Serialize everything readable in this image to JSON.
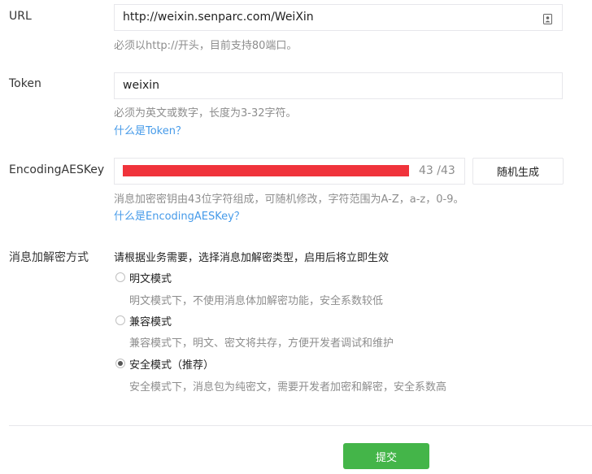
{
  "url": {
    "label": "URL",
    "value": "http://weixin.senparc.com/WeiXin",
    "tip": "必须以http://开头，目前支持80端口。",
    "icon": "contact-card-icon"
  },
  "token": {
    "label": "Token",
    "value": "weixin",
    "tip": "必须为英文或数字，长度为3-32字符。",
    "help_link": "什么是Token？"
  },
  "aes": {
    "label": "EncodingAESKey",
    "counter": "43 /43",
    "generate_button": "随机生成",
    "tip": "消息加密密钥由43位字符组成，可随机修改，字符范围为A-Z，a-z，0-9。",
    "help_link": "什么是EncodingAESKey？",
    "redaction_color": "#f0333b"
  },
  "encryption": {
    "label": "消息加解密方式",
    "intro": "请根据业务需要，选择消息加解密类型，启用后将立即生效",
    "options": [
      {
        "label": "明文模式",
        "desc": "明文模式下，不使用消息体加解密功能，安全系数较低",
        "checked": false
      },
      {
        "label": "兼容模式",
        "desc": "兼容模式下，明文、密文将共存，方便开发者调试和维护",
        "checked": false
      },
      {
        "label": "安全模式（推荐）",
        "desc": "安全模式下，消息包为纯密文，需要开发者加密和解密，安全系数高",
        "checked": true
      }
    ]
  },
  "submit": {
    "label": "提交",
    "color": "#44b549"
  }
}
